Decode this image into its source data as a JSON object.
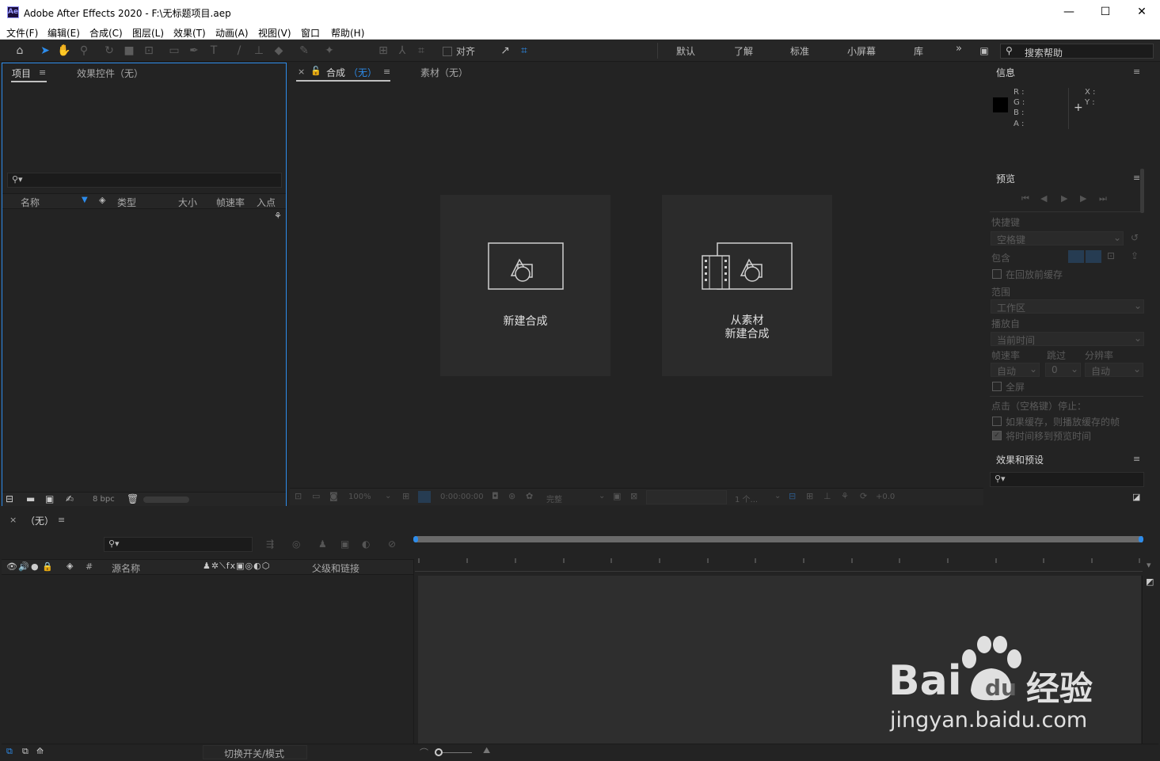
{
  "window": {
    "app_logo": "Ae",
    "title": "Adobe After Effects 2020 - F:\\无标题项目.aep",
    "minimize": "—",
    "maximize": "☐",
    "close": "✕"
  },
  "menu": [
    "文件(F)",
    "编辑(E)",
    "合成(C)",
    "图层(L)",
    "效果(T)",
    "动画(A)",
    "视图(V)",
    "窗口",
    "帮助(H)"
  ],
  "toolbar": {
    "snap_label": "对齐",
    "workspaces": [
      "默认",
      "了解",
      "标准",
      "小屏幕",
      "库"
    ],
    "more": "»",
    "search_placeholder": "搜索帮助"
  },
  "project_panel": {
    "tab_project": "项目",
    "tab_effects": "效果控件（无）",
    "columns": [
      "名称",
      "类型",
      "大小",
      "帧速率",
      "入点"
    ],
    "bpc": "8 bpc"
  },
  "viewer": {
    "close": "×",
    "tab_comp_prefix": "合成",
    "tab_comp_none": "（无）",
    "tab_footage": "素材（无）",
    "card_new_comp": "新建合成",
    "card_from_footage_line1": "从素材",
    "card_from_footage_line2": "新建合成",
    "footer": {
      "zoom": "100%",
      "timecode": "0:00:00:00",
      "resolution": "完整",
      "views": "1 个...",
      "exposure": "+0.0"
    }
  },
  "info_panel": {
    "title": "信息",
    "r": "R :",
    "g": "G :",
    "b": "B :",
    "a": "A :",
    "x": "X :",
    "y": "Y :",
    "swatch_color": "#000000"
  },
  "preview_panel": {
    "title": "预览",
    "shortcut_label": "快捷键",
    "shortcut_value": "空格键",
    "include_label": "包含",
    "cache_before": "在回放前缓存",
    "range_label": "范围",
    "range_value": "工作区",
    "play_from_label": "播放自",
    "play_from_value": "当前时间",
    "frame_rate_label": "帧速率",
    "skip_label": "跳过",
    "resolution_label": "分辨率",
    "frame_rate_value": "自动",
    "skip_value": "0",
    "resolution_value": "自动",
    "fullscreen": "全屏",
    "stop_label": "点击（空格键）停止：",
    "opt_cache_play": "如果缓存，则播放缓存的帧",
    "opt_move_time": "将时间移到预览时间"
  },
  "effects_panel": {
    "title": "效果和预设"
  },
  "timeline": {
    "close": "×",
    "tab_none": "（无）",
    "col_hash": "#",
    "col_source": "源名称",
    "col_parent": "父级和链接",
    "toggle_modes": "切换开关/模式"
  },
  "watermark": {
    "brand": "Bai",
    "brand_suffix": "du",
    "product": "经验",
    "url": "jingyan.baidu.com"
  }
}
